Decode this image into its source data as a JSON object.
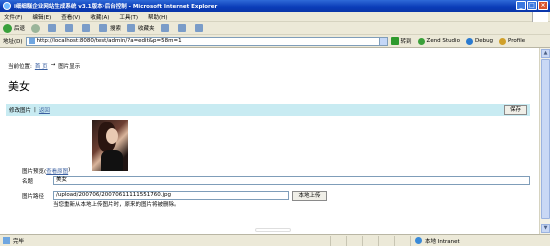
{
  "window": {
    "title": "i细细糕企业网站生成系统 v3.1版本·后台控制 - Microsoft Internet Explorer"
  },
  "menu": [
    "文件(F)",
    "编辑(E)",
    "查看(V)",
    "收藏(A)",
    "工具(T)",
    "帮助(H)"
  ],
  "toolbar": {
    "back": "后退",
    "search": "搜索",
    "favorites": "收藏夹"
  },
  "address": {
    "label": "地址(D)",
    "url": "http://localhost:8080/test/admin/?a=edit&p=58m=1",
    "go": "转到",
    "addons": [
      "Zend Studio",
      "Debug",
      "Profile"
    ]
  },
  "page": {
    "breadcrumb": {
      "prefix": "当前位置:",
      "home": "首 页",
      "arrow": "→",
      "current": "图片显示"
    },
    "heading": "美女",
    "actions": {
      "edit": "修改图片",
      "sep": "|",
      "back": "返回",
      "save": "保存"
    },
    "form": {
      "preview_label": "图片预览(",
      "preview_link": "查看原图",
      "preview_close": ")",
      "name_label": "名题",
      "name_value": "美女",
      "path_label": "图片路径",
      "path_value": "/upload/200706/20070611111551760.jpg",
      "upload_button": "本地上传",
      "hint": "当您重新从本地上传图片时，原来的图片将被删除。"
    }
  },
  "status": {
    "left": "完毕",
    "zone": "本地 Intranet"
  }
}
